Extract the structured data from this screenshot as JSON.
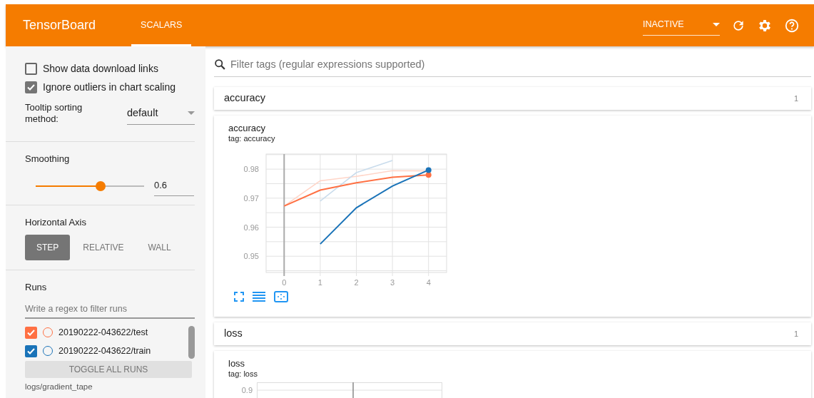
{
  "header": {
    "title": "TensorBoard",
    "tabs": [
      {
        "label": "SCALARS",
        "selected": true
      }
    ],
    "run_status": {
      "value": "INACTIVE"
    }
  },
  "sidebar": {
    "options": [
      {
        "label": "Show data download links",
        "checked": false
      },
      {
        "label": "Ignore outliers in chart scaling",
        "checked": true
      }
    ],
    "tooltip_sorting": {
      "label": "Tooltip sorting method:",
      "value": "default"
    },
    "smoothing": {
      "title": "Smoothing",
      "level": 0.6,
      "value": "0.6"
    },
    "horizontal_axis": {
      "title": "Horizontal Axis",
      "options": [
        {
          "label": "STEP",
          "selected": true
        },
        {
          "label": "RELATIVE",
          "selected": false
        },
        {
          "label": "WALL",
          "selected": false
        }
      ]
    },
    "runs": {
      "title": "Runs",
      "filter_placeholder": "Write a regex to filter runs",
      "items": [
        {
          "name": "20190222-043622/test",
          "checked": true,
          "selected": false,
          "color": "#ff7043"
        },
        {
          "name": "20190222-043622/train",
          "checked": true,
          "selected": false,
          "color": "#1a73b8"
        }
      ],
      "toggle_all": "TOGGLE ALL RUNS",
      "log_dir": "logs/gradient_tape"
    }
  },
  "main": {
    "filter_placeholder": "Filter tags (regular expressions supported)",
    "categories": [
      {
        "name": "accuracy",
        "count": "1",
        "chart": {
          "title": "accuracy",
          "tag": "tag: accuracy",
          "chart_data": {
            "type": "line",
            "x": [
              0,
              1,
              2,
              3,
              4
            ],
            "xlim": [
              -0.5,
              4.5
            ],
            "ylim": [
              0.9444,
              0.9852
            ],
            "xticks": [
              0,
              1,
              2,
              3,
              4
            ],
            "yticks": [
              {
                "value": 0.95,
                "label": "0.95"
              },
              {
                "value": 0.96,
                "label": "0.96"
              },
              {
                "value": 0.97,
                "label": "0.97"
              },
              {
                "value": 0.98,
                "label": "0.98"
              }
            ],
            "series": [
              {
                "color": "#ffd5c8",
                "values": [
                  0.9673,
                  0.976,
                  0.9775,
                  0.9795,
                  0.9794
                ]
              },
              {
                "color": "#c9dcec",
                "values": [
                  null,
                  0.969,
                  0.9788,
                  0.983,
                  null
                ]
              },
              {
                "color": "#ff7043",
                "values": [
                  0.9673,
                  0.9728,
                  0.9753,
                  0.9772,
                  0.978
                ]
              },
              {
                "color": "#1a73b8",
                "values": [
                  null,
                  0.9542,
                  0.9667,
                  0.9742,
                  0.9797
                ]
              }
            ],
            "grid": true
          }
        }
      },
      {
        "name": "loss",
        "count": "1",
        "chart": {
          "title": "loss",
          "tag": "tag: loss",
          "y_tick": "0.9"
        }
      }
    ]
  }
}
